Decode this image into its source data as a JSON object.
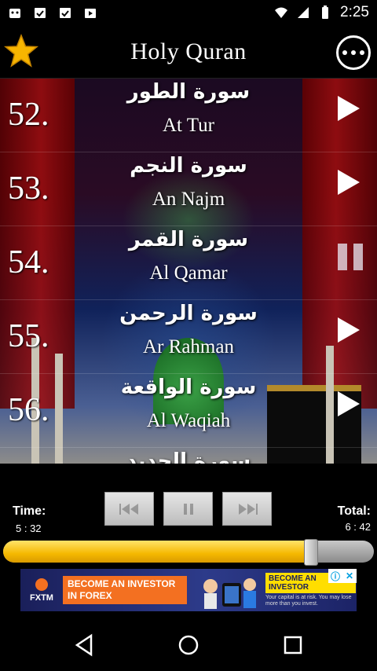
{
  "status": {
    "time": "2:25"
  },
  "header": {
    "title": "Holy Quran"
  },
  "surahs": [
    {
      "num": "52.",
      "ar": "سورة الطور",
      "en": "At Tur",
      "state": "play"
    },
    {
      "num": "53.",
      "ar": "سورة النجم",
      "en": "An Najm",
      "state": "play"
    },
    {
      "num": "54.",
      "ar": "سورة القمر",
      "en": "Al Qamar",
      "state": "pause"
    },
    {
      "num": "55.",
      "ar": "سورة الرحمن",
      "en": "Ar Rahman",
      "state": "play"
    },
    {
      "num": "56.",
      "ar": "سورة الواقعة",
      "en": "Al Waqiah",
      "state": "play"
    },
    {
      "num": "",
      "ar": "سورة الحديد",
      "en": "",
      "state": "play"
    }
  ],
  "player": {
    "time_label": "Time:",
    "time_value": "5 : 32",
    "total_label": "Total:",
    "total_value": "6 : 42",
    "progress": 0.83
  },
  "ad": {
    "brand": "FXTM",
    "cta_left": "BECOME AN INVESTOR IN FOREX",
    "cta_right": "BECOME AN INVESTOR",
    "risk": "Your capital is at risk. You may lose more than you invest."
  }
}
